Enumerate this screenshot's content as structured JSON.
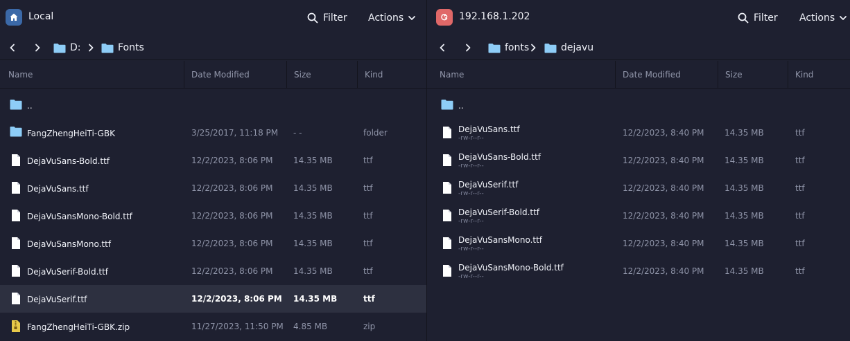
{
  "local": {
    "title": "Local",
    "icon": "home-icon",
    "filter_label": "Filter",
    "actions_label": "Actions",
    "breadcrumb": [
      "D:",
      "Fonts"
    ],
    "columns": [
      "Name",
      "Date Modified",
      "Size",
      "Kind"
    ],
    "parent": "..",
    "rows": [
      {
        "name": "FangZhengHeiTi-GBK",
        "date": "3/25/2017, 11:18 PM",
        "size": "- -",
        "kind": "folder",
        "icon": "folder-icon"
      },
      {
        "name": "DejaVuSans-Bold.ttf",
        "date": "12/2/2023, 8:06 PM",
        "size": "14.35 MB",
        "kind": "ttf",
        "icon": "file-icon"
      },
      {
        "name": "DejaVuSans.ttf",
        "date": "12/2/2023, 8:06 PM",
        "size": "14.35 MB",
        "kind": "ttf",
        "icon": "file-icon"
      },
      {
        "name": "DejaVuSansMono-Bold.ttf",
        "date": "12/2/2023, 8:06 PM",
        "size": "14.35 MB",
        "kind": "ttf",
        "icon": "file-icon"
      },
      {
        "name": "DejaVuSansMono.ttf",
        "date": "12/2/2023, 8:06 PM",
        "size": "14.35 MB",
        "kind": "ttf",
        "icon": "file-icon"
      },
      {
        "name": "DejaVuSerif-Bold.ttf",
        "date": "12/2/2023, 8:06 PM",
        "size": "14.35 MB",
        "kind": "ttf",
        "icon": "file-icon"
      },
      {
        "name": "DejaVuSerif.ttf",
        "date": "12/2/2023, 8:06 PM",
        "size": "14.35 MB",
        "kind": "ttf",
        "icon": "file-icon",
        "selected": true
      },
      {
        "name": "FangZhengHeiTi-GBK.zip",
        "date": "11/27/2023, 11:50 PM",
        "size": "4.85 MB",
        "kind": "zip",
        "icon": "zip-file-icon"
      }
    ]
  },
  "remote": {
    "title": "192.168.1.202",
    "icon": "debian-icon",
    "filter_label": "Filter",
    "actions_label": "Actions",
    "breadcrumb": [
      "fonts",
      "dejavu"
    ],
    "columns": [
      "Name",
      "Date Modified",
      "Size",
      "Kind"
    ],
    "parent": "..",
    "rows": [
      {
        "name": "DejaVuSans.ttf",
        "perm": "-rw-r--r--",
        "date": "12/2/2023, 8:40 PM",
        "size": "14.35 MB",
        "kind": "ttf",
        "icon": "file-icon"
      },
      {
        "name": "DejaVuSans-Bold.ttf",
        "perm": "-rw-r--r--",
        "date": "12/2/2023, 8:40 PM",
        "size": "14.35 MB",
        "kind": "ttf",
        "icon": "file-icon"
      },
      {
        "name": "DejaVuSerif.ttf",
        "perm": "-rw-r--r--",
        "date": "12/2/2023, 8:40 PM",
        "size": "14.35 MB",
        "kind": "ttf",
        "icon": "file-icon"
      },
      {
        "name": "DejaVuSerif-Bold.ttf",
        "perm": "-rw-r--r--",
        "date": "12/2/2023, 8:40 PM",
        "size": "14.35 MB",
        "kind": "ttf",
        "icon": "file-icon"
      },
      {
        "name": "DejaVuSansMono.ttf",
        "perm": "-rw-r--r--",
        "date": "12/2/2023, 8:40 PM",
        "size": "14.35 MB",
        "kind": "ttf",
        "icon": "file-icon"
      },
      {
        "name": "DejaVuSansMono-Bold.ttf",
        "perm": "-rw-r--r--",
        "date": "12/2/2023, 8:40 PM",
        "size": "14.35 MB",
        "kind": "ttf",
        "icon": "file-icon"
      }
    ]
  },
  "colors": {
    "background": "#1e2030",
    "selected_row": "#2d3040",
    "folder": "#8ecdf7",
    "local_badge": "#3b69a8",
    "remote_badge": "#e06868",
    "zip_icon": "#e8c94a"
  }
}
